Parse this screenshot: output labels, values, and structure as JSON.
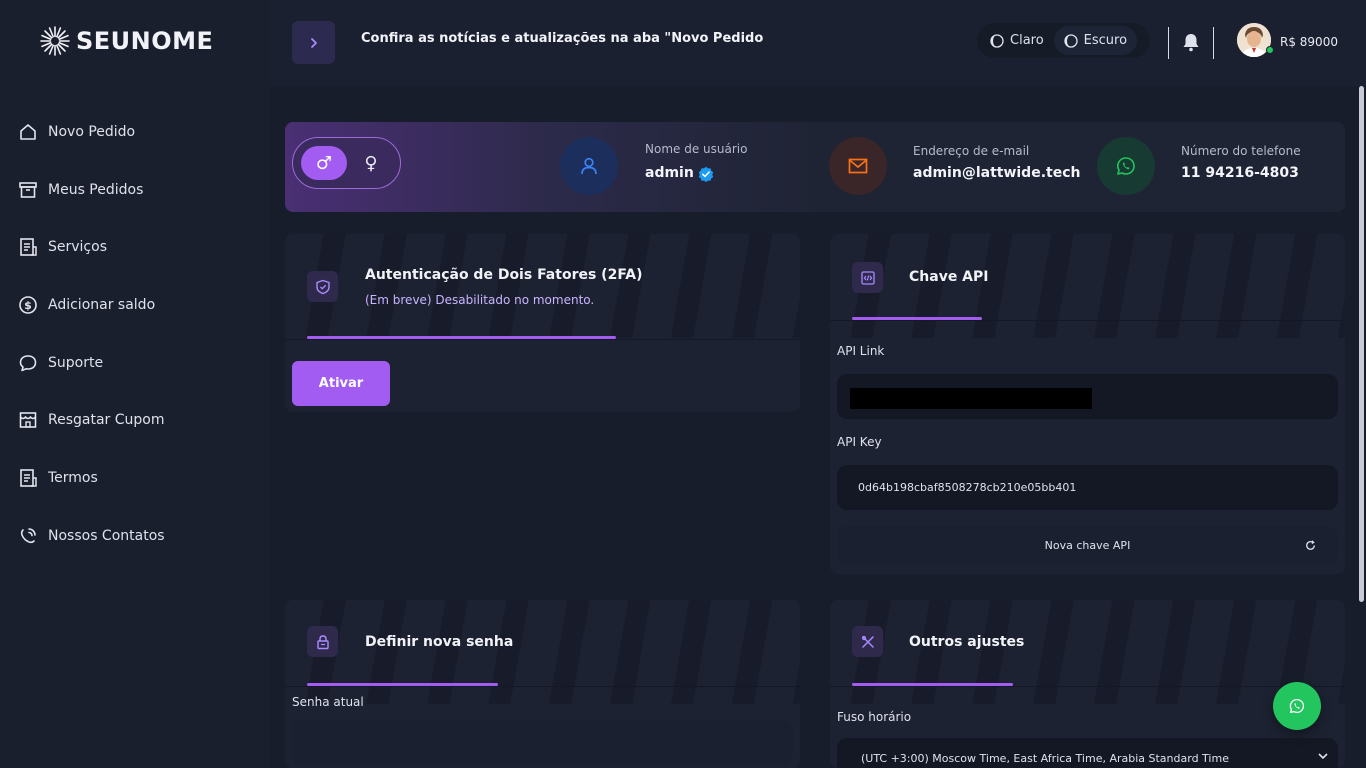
{
  "brand": {
    "name": "SEUNOME"
  },
  "sidebar": {
    "items": [
      {
        "label": "Novo Pedido",
        "icon": "home-icon"
      },
      {
        "label": "Meus Pedidos",
        "icon": "archive-icon"
      },
      {
        "label": "Serviços",
        "icon": "document-list-icon"
      },
      {
        "label": "Adicionar saldo",
        "icon": "dollar-circle-icon"
      },
      {
        "label": "Suporte",
        "icon": "chat-bubble-icon"
      },
      {
        "label": "Resgatar Cupom",
        "icon": "store-icon"
      },
      {
        "label": "Termos",
        "icon": "document-list-icon"
      },
      {
        "label": "Nossos Contatos",
        "icon": "contacts-icon"
      }
    ]
  },
  "topbar": {
    "announcement": "Confira as notícias e atualizações na aba \"Novo Pedido",
    "theme_light": "Claro",
    "theme_dark": "Escuro",
    "balance": "R$ 89000"
  },
  "profile": {
    "username_label": "Nome de usuário",
    "username": "admin",
    "email_label": "Endereço de e-mail",
    "email": "admin@lattwide.tech",
    "phone_label": "Número do telefone",
    "phone": "11 94216-4803",
    "gender_male": "♂",
    "gender_female": "♀"
  },
  "twofa": {
    "title": "Autenticação de Dois Fatores (2FA)",
    "subtitle": "(Em breve) Desabilitado no momento.",
    "button": "Ativar"
  },
  "api": {
    "title": "Chave API",
    "link_label": "API Link",
    "key_label": "API Key",
    "key_value": "0d64b198cbaf8508278cb210e05bb401",
    "new_key_button": "Nova chave API"
  },
  "password": {
    "title": "Definir nova senha",
    "current_label": "Senha atual"
  },
  "other": {
    "title": "Outros ajustes",
    "timezone_label": "Fuso horário",
    "timezone_value": "(UTC +3:00) Moscow Time, East Africa Time, Arabia Standard Time"
  },
  "colors": {
    "accent": "#a35cf2",
    "background": "#181d2b",
    "whatsapp": "#22c55e"
  }
}
